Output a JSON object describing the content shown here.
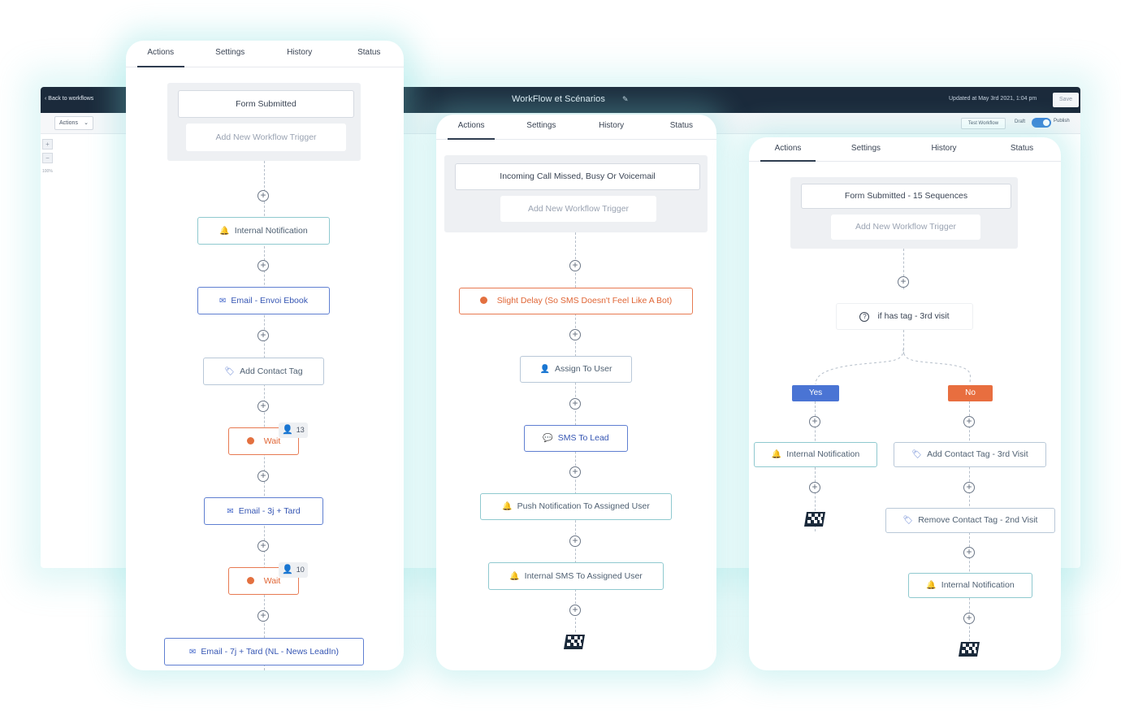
{
  "editor": {
    "back_label": "‹ Back to workflows",
    "title": "WorkFlow et Scénarios",
    "edit_icon": "pencil-icon",
    "updated": "Updated at May 3rd 2021, 1:04 pm",
    "save": "Save",
    "actions_dropdown": "Actions",
    "test_workflow": "Test Workflow",
    "draft": "Draft",
    "publish": "Publish",
    "zoom_in": "+",
    "zoom_out": "−",
    "zoom_level": "100%"
  },
  "tabs": [
    "Actions",
    "Settings",
    "History",
    "Status"
  ],
  "panel1": {
    "trigger": "Form Submitted",
    "add_trigger": "Add New Workflow Trigger",
    "nodes": [
      {
        "label": "Internal Notification",
        "icon": "bell-icon"
      },
      {
        "label": "Email - Envoi Ebook",
        "icon": "mail-icon"
      },
      {
        "label": "Add Contact Tag",
        "icon": "tag-icon"
      },
      {
        "label": "Wait",
        "icon": "clock-icon",
        "badge": "13"
      },
      {
        "label": "Email - 3j + Tard",
        "icon": "mail-icon"
      },
      {
        "label": "Wait",
        "icon": "clock-icon",
        "badge": "10"
      },
      {
        "label": "Email - 7j + Tard (NL - News LeadIn)",
        "icon": "mail-icon"
      }
    ]
  },
  "panel2": {
    "trigger": "Incoming Call Missed, Busy Or Voicemail",
    "add_trigger": "Add New Workflow Trigger",
    "nodes": [
      {
        "label": "Slight Delay (So SMS Doesn't Feel Like A Bot)",
        "icon": "clock-icon"
      },
      {
        "label": "Assign To User",
        "icon": "user-icon"
      },
      {
        "label": "SMS To Lead",
        "icon": "sms-icon"
      },
      {
        "label": "Push Notification To Assigned User",
        "icon": "bell-icon"
      },
      {
        "label": "Internal SMS To Assigned User",
        "icon": "bell-icon"
      }
    ]
  },
  "panel3": {
    "trigger": "Form Submitted - 15 Sequences",
    "add_trigger": "Add New Workflow Trigger",
    "condition": "if has tag - 3rd visit",
    "yes_label": "Yes",
    "no_label": "No",
    "yes_branch": [
      {
        "label": "Internal Notification",
        "icon": "bell-icon"
      }
    ],
    "no_branch": [
      {
        "label": "Add Contact Tag - 3rd Visit",
        "icon": "tag-icon"
      },
      {
        "label": "Remove Contact Tag - 2nd Visit",
        "icon": "tag-icon"
      },
      {
        "label": "Internal Notification",
        "icon": "bell-icon"
      }
    ]
  },
  "colors": {
    "topbar": "#1b2a3b",
    "accent_blue": "#3f63c9",
    "wait_orange": "#e06636",
    "yes_blue": "#4a74d4",
    "no_orange": "#e86e3f"
  }
}
